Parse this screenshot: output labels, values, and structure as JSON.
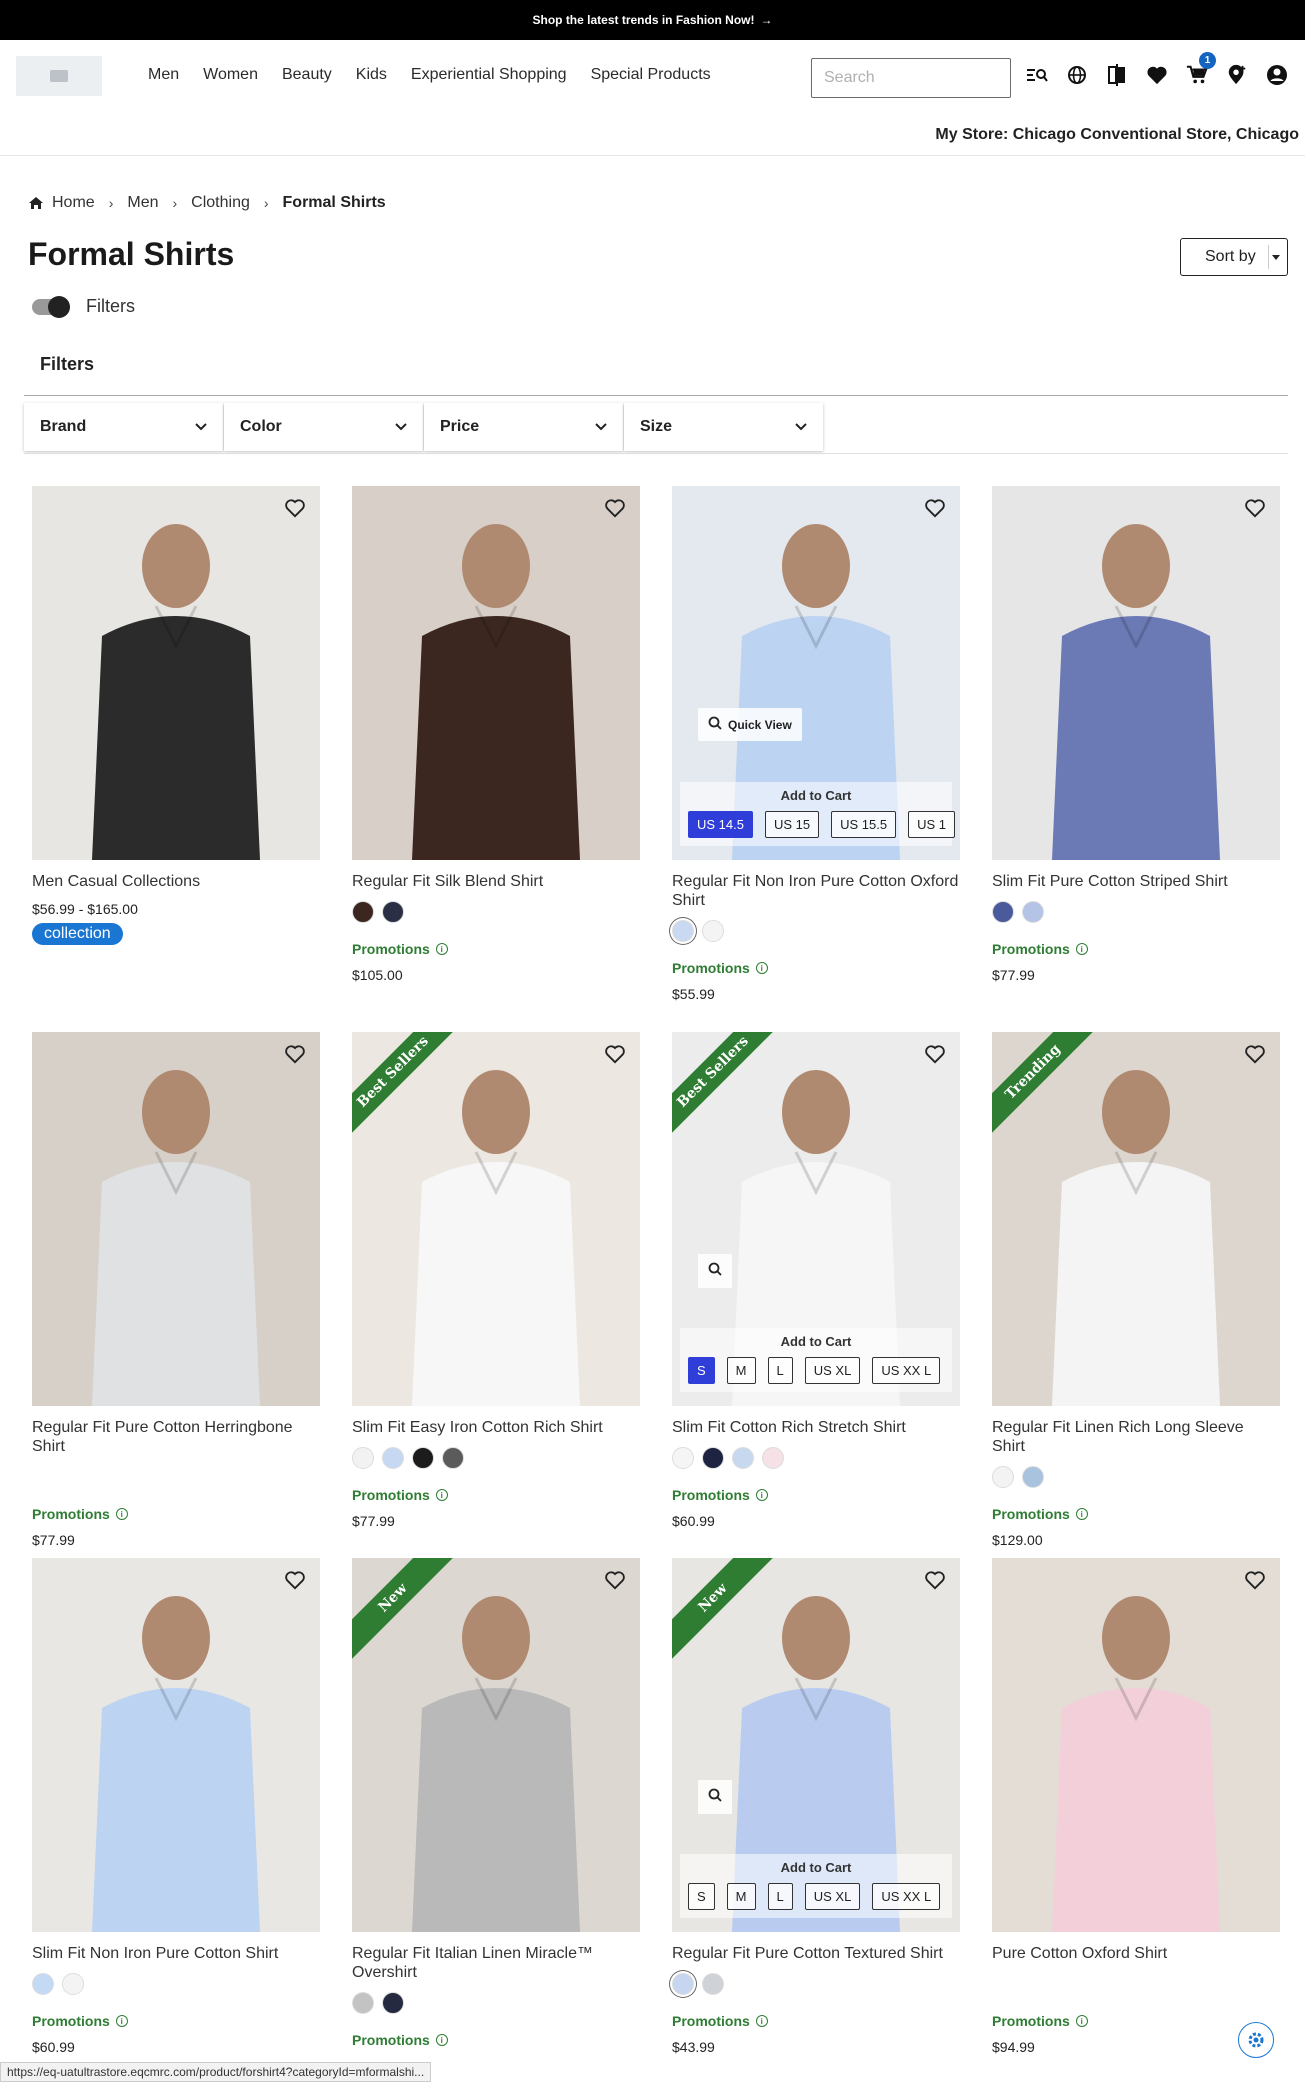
{
  "promo_bar": {
    "text": "Shop the latest trends in Fashion Now!"
  },
  "nav": [
    "Men",
    "Women",
    "Beauty",
    "Kids",
    "Experiential Shopping",
    "Special Products"
  ],
  "search": {
    "placeholder": "Search"
  },
  "cart_count": "1",
  "my_store": "My Store: Chicago Conventional Store, Chicago",
  "breadcrumb": [
    "Home",
    "Men",
    "Clothing",
    "Formal Shirts"
  ],
  "page_title": "Formal Shirts",
  "sort_label": "Sort by",
  "filters_toggle_label": "Filters",
  "filters_heading": "Filters",
  "filter_dropdowns": [
    "Brand",
    "Color",
    "Price",
    "Size"
  ],
  "promotions_label": "Promotions",
  "add_to_cart_label": "Add to Cart",
  "quick_view_label": "Quick View",
  "products": [
    {
      "name": "Men Casual Collections",
      "price": "$56.99 - $165.00",
      "pill": "collection",
      "colors": [],
      "ribbon": ""
    },
    {
      "name": "Regular Fit Silk Blend Shirt",
      "price": "$105.00",
      "colors": [
        "#3b2720",
        "#2a2f45"
      ],
      "ribbon": ""
    },
    {
      "name": "Regular Fit Non Iron Pure Cotton Oxford Shirt",
      "price": "$55.99",
      "colors": [
        "#c9d9f2",
        "#f4f4f4"
      ],
      "ribbon": "",
      "sizes": [
        "US 14.5",
        "US 15",
        "US 15.5",
        "US 1"
      ]
    },
    {
      "name": "Slim Fit Pure Cotton Striped Shirt",
      "price": "$77.99",
      "colors": [
        "#4a5a9a",
        "#b5c4e6"
      ],
      "ribbon": ""
    },
    {
      "name": "Regular Fit Pure Cotton Herringbone Shirt",
      "price": "$77.99",
      "colors": [],
      "ribbon": ""
    },
    {
      "name": "Slim Fit Easy Iron Cotton Rich Shirt",
      "price": "$77.99",
      "colors": [
        "#f2f2f2",
        "#c7d8f2",
        "#1c1c1c",
        "#5b5b5b"
      ],
      "ribbon": "Best Sellers"
    },
    {
      "name": "Slim Fit Cotton Rich Stretch Shirt",
      "price": "$60.99",
      "colors": [
        "#f5f5f5",
        "#1d2340",
        "#c8d9ef",
        "#f5e1e6"
      ],
      "ribbon": "Best Sellers",
      "sizes": [
        "S",
        "M",
        "L",
        "US XL",
        "US XX L"
      ]
    },
    {
      "name": "Regular Fit Linen Rich Long Sleeve Shirt",
      "price": "$129.00",
      "colors": [
        "#f3f3f3",
        "#a9c3de"
      ],
      "ribbon": "Trending"
    },
    {
      "name": "Slim Fit Non Iron Pure Cotton Shirt",
      "price": "$60.99",
      "colors": [
        "#c4d9f3",
        "#f4f4f4"
      ],
      "ribbon": ""
    },
    {
      "name": "Regular Fit Italian Linen Miracle™ Overshirt",
      "price": "",
      "colors": [
        "#c3c3c3",
        "#252a40"
      ],
      "ribbon": "New"
    },
    {
      "name": "Regular Fit Pure Cotton Textured Shirt",
      "price": "$43.99",
      "colors": [
        "#c7d6f0",
        "#cfd3d8"
      ],
      "ribbon": "New",
      "sizes": [
        "S",
        "M",
        "L",
        "US XL",
        "US XX L"
      ]
    },
    {
      "name": "Pure Cotton Oxford Shirt",
      "price": "$94.99",
      "colors": [],
      "ribbon": ""
    }
  ],
  "status_url": "https://eq-uatultrastore.eqcmrc.com/product/forshirt4?categoryId=mformalshi...",
  "icons": [
    "image-icon",
    "visual-search-icon",
    "globe-icon",
    "compare-icon",
    "heart-icon",
    "cart-icon",
    "location-icon",
    "account-icon"
  ]
}
